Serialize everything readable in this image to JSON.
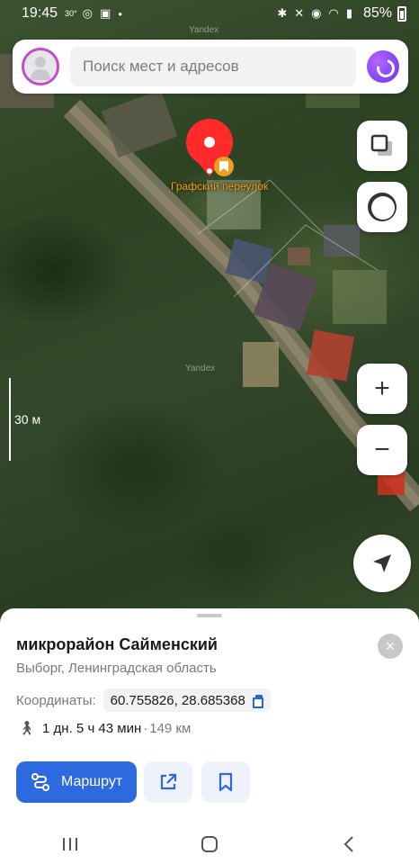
{
  "status_bar": {
    "time": "19:45",
    "temp": "30°",
    "battery": "85%"
  },
  "search": {
    "placeholder": "Поиск мест и адресов"
  },
  "map": {
    "pin_label": "Графский переулок",
    "scale_label": "30 м",
    "watermark": "Yandex",
    "zoom_in": "+",
    "zoom_out": "−"
  },
  "card": {
    "title": "микрорайон Сайменский",
    "subtitle": "Выборг, Ленинградская область",
    "coords_label": "Координаты:",
    "coords_value": "60.755826, 28.685368",
    "walk_time": "1 дн. 5 ч 43 мин",
    "walk_separator": "·",
    "walk_distance": "149 км",
    "route_label": "Маршрут",
    "close_glyph": "×"
  },
  "colors": {
    "accent": "#2d6ae0",
    "pin": "#ff2a2a",
    "label": "#f0a020"
  }
}
